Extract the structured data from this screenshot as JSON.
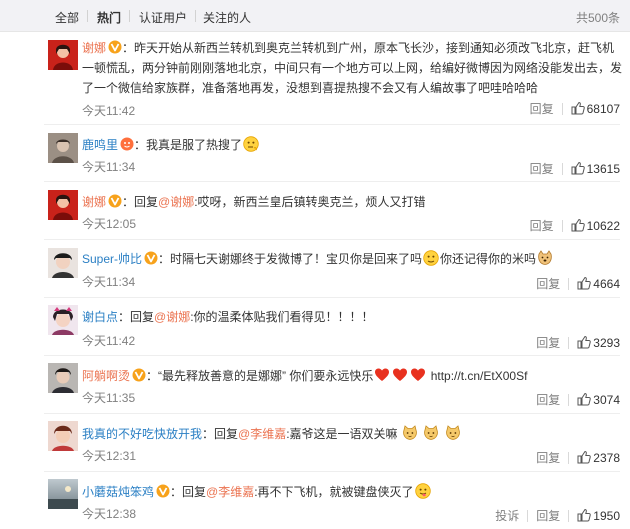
{
  "tabs": [
    {
      "label": "全部"
    },
    {
      "label": "热门"
    },
    {
      "label": "认证用户"
    },
    {
      "label": "关注的人"
    }
  ],
  "total_label": "共500条",
  "actions": {
    "reply": "回复",
    "report": "投诉"
  },
  "colors": {
    "orange": "#eb7350",
    "blue": "#2a7fc4",
    "gray": "#808080",
    "tab_bg": "#f2f2f5"
  },
  "comments": [
    {
      "user": "谢娜",
      "badge": "verified-gold",
      "text": "：昨天开始从新西兰转机到奥克兰转机到广州，原本飞长沙，接到通知必须改飞北京，赶飞机一顿慌乱，两分钟前刚刚落地北京，中间只有一个地方可以上网，给编好微博因为网络没能发出去，发了一个微信给家族群，准备落地再发，没想到喜提热搜不会又有人编故事了吧哇哈哈哈",
      "time": "今天11:42",
      "likes": "68107"
    },
    {
      "user": "鹿鸣里",
      "badge": "emoji-badge",
      "text": "：我真是服了热搜了",
      "emoji_end": "thinking-emoji",
      "time": "今天11:34",
      "likes": "13615"
    },
    {
      "user": "谢娜",
      "badge": "verified-gold",
      "prefix": "：回复",
      "mention": "@谢娜",
      "text": ":哎呀，新西兰皇后镇转奥克兰，烦人又打错",
      "time": "今天12:05",
      "likes": "10622"
    },
    {
      "user": "Super-帅比",
      "badge": "verified-gold",
      "text": "：时隔七天谢娜终于发微博了！宝贝你是回来了吗",
      "emoji_mid": "wink-emoji",
      "text2": "你还记得你的米吗",
      "emoji_end": "dog-emoji",
      "time": "今天11:34",
      "likes": "4664"
    },
    {
      "user": "谢白点",
      "prefix": "：回复",
      "mention": "@谢娜",
      "text": ":你的温柔体贴我们看得见！！！！",
      "time": "今天11:42",
      "likes": "3293"
    },
    {
      "user": "阿躺啊烫",
      "badge": "verified-gold",
      "text": "：“最先释放善意的是娜娜” 你们要永远快乐",
      "hearts": [
        "heart-icon",
        "heart-icon",
        "heart-icon"
      ],
      "link": "http://t.cn/EtX00Sf",
      "time": "今天11:35",
      "likes": "3074"
    },
    {
      "user": "我真的不好吃快放开我",
      "prefix": "：回复",
      "mention": "@李维嘉",
      "text": ":嘉爷这是一语双关嘛",
      "cats": [
        "cat-emoji",
        "cat-emoji",
        "cat-emoji"
      ],
      "time": "今天12:31",
      "likes": "2378"
    },
    {
      "user": "小蘑菇炖笨鸡",
      "badge": "verified-gold",
      "prefix": "：回复",
      "mention": "@李维嘉",
      "text": ":再不下飞机，就被键盘侠灭了",
      "emoji_end": "tongue-emoji",
      "time": "今天12:38",
      "likes": "1950",
      "show_report": true
    }
  ]
}
